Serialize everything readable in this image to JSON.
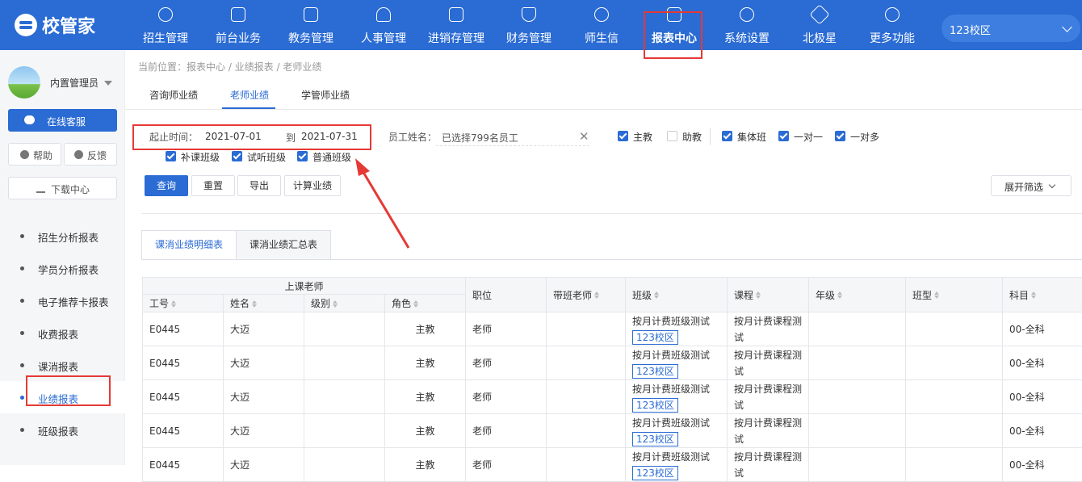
{
  "brand": {
    "name": "校管家"
  },
  "nav": {
    "items": [
      {
        "label": "招生管理",
        "icon": "person-add-icon"
      },
      {
        "label": "前台业务",
        "icon": "monitor-icon"
      },
      {
        "label": "教务管理",
        "icon": "book-icon"
      },
      {
        "label": "人事管理",
        "icon": "person-icon"
      },
      {
        "label": "进销存管理",
        "icon": "inventory-icon"
      },
      {
        "label": "财务管理",
        "icon": "yuan-shield-icon"
      },
      {
        "label": "师生信",
        "icon": "message-icon"
      },
      {
        "label": "报表中心",
        "icon": "chart-icon"
      },
      {
        "label": "系统设置",
        "icon": "gear-icon"
      },
      {
        "label": "北极星",
        "icon": "star-icon"
      },
      {
        "label": "更多功能",
        "icon": "more-icon"
      }
    ],
    "active": "报表中心"
  },
  "campus_selector": {
    "value": "123校区"
  },
  "user": {
    "name": "内置管理员"
  },
  "sidebar": {
    "service_label": "在线客服",
    "help_label": "帮助",
    "feedback_label": "反馈",
    "download_label": "下载中心",
    "items": [
      {
        "label": "招生分析报表"
      },
      {
        "label": "学员分析报表"
      },
      {
        "label": "电子推荐卡报表"
      },
      {
        "label": "收费报表"
      },
      {
        "label": "课消报表"
      },
      {
        "label": "业绩报表"
      },
      {
        "label": "班级报表"
      }
    ],
    "active": "业绩报表"
  },
  "breadcrumb": "当前位置：报表中心 / 业绩报表 / 老师业绩",
  "tabs": [
    {
      "label": "咨询师业绩"
    },
    {
      "label": "老师业绩"
    },
    {
      "label": "学管师业绩"
    }
  ],
  "active_tab": "老师业绩",
  "filters": {
    "date_label": "起止时间：",
    "date_start": "2021-07-01",
    "date_to": "到",
    "date_end": "2021-07-31",
    "employee_label": "员工姓名：",
    "employee_value": "已选择799名员工",
    "checkboxes": [
      {
        "label": "主教",
        "checked": true
      },
      {
        "label": "助教",
        "checked": false
      },
      {
        "label": "集体班",
        "checked": true
      },
      {
        "label": "一对一",
        "checked": true
      },
      {
        "label": "一对多",
        "checked": true
      },
      {
        "label": "补课班级",
        "checked": true
      },
      {
        "label": "试听班级",
        "checked": true
      },
      {
        "label": "普通班级",
        "checked": true
      }
    ]
  },
  "actions": {
    "query": "查询",
    "reset": "重置",
    "export": "导出",
    "calculate": "计算业绩",
    "expand": "展开筛选"
  },
  "subtabs": [
    {
      "label": "课消业绩明细表"
    },
    {
      "label": "课消业绩汇总表"
    }
  ],
  "active_subtab": "课消业绩明细表",
  "table": {
    "group_header": "上课老师",
    "columns": [
      "工号",
      "姓名",
      "级别",
      "角色",
      "职位",
      "带班老师",
      "班级",
      "课程",
      "年级",
      "班型",
      "科目"
    ],
    "rows": [
      {
        "id": "E0445",
        "name": "大迈",
        "level": "",
        "role": "主教",
        "position": "老师",
        "head_teacher": "",
        "class_name": "按月计费班级测试",
        "campus": "123校区",
        "course": "按月计费课程测试",
        "grade": "",
        "class_type": "",
        "subject": "00-全科"
      },
      {
        "id": "E0445",
        "name": "大迈",
        "level": "",
        "role": "主教",
        "position": "老师",
        "head_teacher": "",
        "class_name": "按月计费班级测试",
        "campus": "123校区",
        "course": "按月计费课程测试",
        "grade": "",
        "class_type": "",
        "subject": "00-全科"
      },
      {
        "id": "E0445",
        "name": "大迈",
        "level": "",
        "role": "主教",
        "position": "老师",
        "head_teacher": "",
        "class_name": "按月计费班级测试",
        "campus": "123校区",
        "course": "按月计费课程测试",
        "grade": "",
        "class_type": "",
        "subject": "00-全科"
      },
      {
        "id": "E0445",
        "name": "大迈",
        "level": "",
        "role": "主教",
        "position": "老师",
        "head_teacher": "",
        "class_name": "按月计费班级测试",
        "campus": "123校区",
        "course": "按月计费课程测试",
        "grade": "",
        "class_type": "",
        "subject": "00-全科"
      },
      {
        "id": "E0445",
        "name": "大迈",
        "level": "",
        "role": "主教",
        "position": "老师",
        "head_teacher": "",
        "class_name": "按月计费班级测试",
        "campus": "123校区",
        "course": "按月计费课程测试",
        "grade": "",
        "class_type": "",
        "subject": "00-全科"
      }
    ]
  },
  "colors": {
    "brand_blue": "#2a6bd4",
    "highlight_red": "#e53935"
  }
}
